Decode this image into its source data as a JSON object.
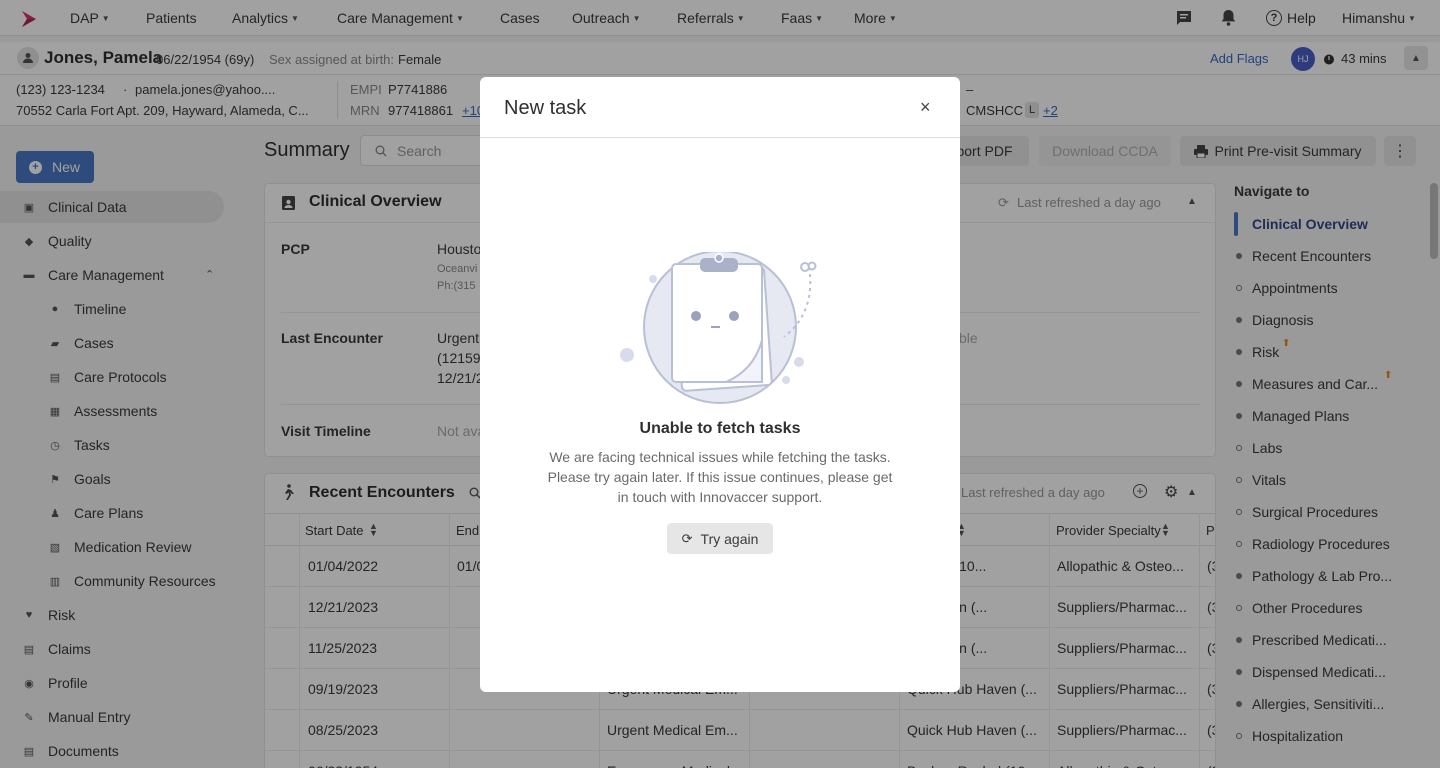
{
  "topnav": {
    "items": [
      {
        "label": "DAP",
        "caret": true
      },
      {
        "label": "Patients",
        "caret": false
      },
      {
        "label": "Analytics",
        "caret": true
      },
      {
        "label": "Care Management",
        "caret": true
      },
      {
        "label": "Cases",
        "caret": false
      },
      {
        "label": "Outreach",
        "caret": true
      },
      {
        "label": "Referrals",
        "caret": true
      },
      {
        "label": "Faas",
        "caret": true
      },
      {
        "label": "More",
        "caret": true
      }
    ],
    "help": "Help",
    "user": "Himanshu"
  },
  "patient": {
    "name": "Jones, Pamela",
    "dob": "06/22/1954 (69y)",
    "sex_label": "Sex assigned at birth:",
    "sex": "Female",
    "add_flags": "Add Flags",
    "avatar": "HJ",
    "timer": "43 mins",
    "phone": "(123) 123-1234",
    "sep": "·",
    "email": "pamela.jones@yahoo....",
    "address": "70552 Carla Fort Apt. 209, Hayward, Alameda, C...",
    "empi_label": "EMPI",
    "empi": "P7741886",
    "mrn_label": "MRN",
    "mrn": "977418861",
    "mrn_more": "+10",
    "dash": "–",
    "cmshcc": "CMSHCC",
    "cmshcc_badge": "L",
    "cmshcc_more": "+2"
  },
  "sidebar": {
    "new_button": "New",
    "items": [
      {
        "label": "Clinical Data",
        "icon": "clipboard-icon",
        "active": true,
        "child": false
      },
      {
        "label": "Quality",
        "icon": "shield-icon",
        "child": false
      },
      {
        "label": "Care Management",
        "icon": "chat-icon",
        "child": false,
        "expanded": true
      },
      {
        "label": "Timeline",
        "icon": "people-icon",
        "child": true
      },
      {
        "label": "Cases",
        "icon": "folder-icon",
        "child": true
      },
      {
        "label": "Care Protocols",
        "icon": "protocol-icon",
        "child": true
      },
      {
        "label": "Assessments",
        "icon": "assessment-icon",
        "child": true
      },
      {
        "label": "Tasks",
        "icon": "alarm-icon",
        "child": true
      },
      {
        "label": "Goals",
        "icon": "goal-icon",
        "child": true
      },
      {
        "label": "Care Plans",
        "icon": "walk-icon",
        "child": true
      },
      {
        "label": "Medication Review",
        "icon": "med-review-icon",
        "child": true
      },
      {
        "label": "Community Resources",
        "icon": "building-icon",
        "child": true
      },
      {
        "label": "Risk",
        "icon": "heart-icon",
        "child": false
      },
      {
        "label": "Claims",
        "icon": "claims-icon",
        "child": false
      },
      {
        "label": "Profile",
        "icon": "profile-icon",
        "child": false
      },
      {
        "label": "Manual Entry",
        "icon": "pencil-icon",
        "child": false
      },
      {
        "label": "Documents",
        "icon": "document-icon",
        "child": false
      }
    ]
  },
  "main": {
    "title": "Summary",
    "search_placeholder": "Search",
    "export_pdf": "port PDF",
    "download_ccda": "Download CCDA",
    "print_summary": "Print Pre-visit Summary",
    "clinical": {
      "title": "Clinical Overview",
      "refreshed": "Last refreshed a day ago",
      "pcp_label": "PCP",
      "pcp_name": "Housto",
      "pcp_loc": "Oceanvi",
      "pcp_phone": "Ph:(315",
      "last_enc_label": "Last Encounter",
      "last_enc_1": "Urgent",
      "last_enc_2": "(12159",
      "last_enc_3": "12/21/2",
      "last_enc_right": "ble",
      "visit_label": "Visit Timeline",
      "visit_value": "Not ava"
    },
    "encounters": {
      "title": "Recent Encounters",
      "refreshed": "Last refreshed a day ago",
      "headers": [
        "Start Date",
        "End",
        "",
        "",
        "Provider Specialty",
        "Pr"
      ],
      "rows": [
        {
          "start": "01/04/2022",
          "end": "01/0",
          "type": "",
          "provider": "Rachel (10...",
          "specialty": "Allopathic & Osteo...",
          "pr": "(3"
        },
        {
          "start": "12/21/2023",
          "end": "",
          "type": "",
          "provider": "ub Haven (...",
          "specialty": "Suppliers/Pharmac...",
          "pr": "(3"
        },
        {
          "start": "11/25/2023",
          "end": "",
          "type": "",
          "provider": "ub Haven (...",
          "specialty": "Suppliers/Pharmac...",
          "pr": "(3"
        },
        {
          "start": "09/19/2023",
          "end": "",
          "type": "Urgent Medical Em...",
          "provider": "Quick Hub Haven (...",
          "specialty": "Suppliers/Pharmac...",
          "pr": "(3"
        },
        {
          "start": "08/25/2023",
          "end": "",
          "type": "Urgent Medical Em...",
          "provider": "Quick Hub Haven (...",
          "specialty": "Suppliers/Pharmac...",
          "pr": "(3"
        },
        {
          "start": "06/22/1954",
          "end": "",
          "type": "Emergency Medical",
          "provider": "Becker, Rachel (10...",
          "specialty": "Allopathic & Osteo...",
          "pr": "(3"
        }
      ]
    }
  },
  "rightnav": {
    "title": "Navigate to",
    "items": [
      {
        "label": "Clinical Overview",
        "active": true
      },
      {
        "label": "Recent Encounters",
        "dot": "filled"
      },
      {
        "label": "Appointments",
        "dot": "hollow"
      },
      {
        "label": "Diagnosis",
        "dot": "filled"
      },
      {
        "label": "Risk",
        "dot": "filled",
        "flag": true
      },
      {
        "label": "Measures and Car...",
        "dot": "filled",
        "flag": true
      },
      {
        "label": "Managed Plans",
        "dot": "filled"
      },
      {
        "label": "Labs",
        "dot": "hollow"
      },
      {
        "label": "Vitals",
        "dot": "hollow"
      },
      {
        "label": "Surgical Procedures",
        "dot": "hollow"
      },
      {
        "label": "Radiology Procedures",
        "dot": "hollow"
      },
      {
        "label": "Pathology & Lab Pro...",
        "dot": "filled"
      },
      {
        "label": "Other Procedures",
        "dot": "hollow"
      },
      {
        "label": "Prescribed Medicati...",
        "dot": "filled"
      },
      {
        "label": "Dispensed Medicati...",
        "dot": "filled"
      },
      {
        "label": "Allergies, Sensitiviti...",
        "dot": "filled"
      },
      {
        "label": "Hospitalization",
        "dot": "hollow"
      }
    ]
  },
  "modal": {
    "title": "New task",
    "error_title": "Unable to fetch tasks",
    "error_message": "We are facing technical issues while fetching the tasks. Please try again later. If this issue continues, please get in touch with Innovaccer support.",
    "retry_button": "Try again"
  },
  "colors": {
    "primary": "#4a78c8",
    "accent_red": "#d6336c",
    "flag_orange": "#e8862a"
  }
}
